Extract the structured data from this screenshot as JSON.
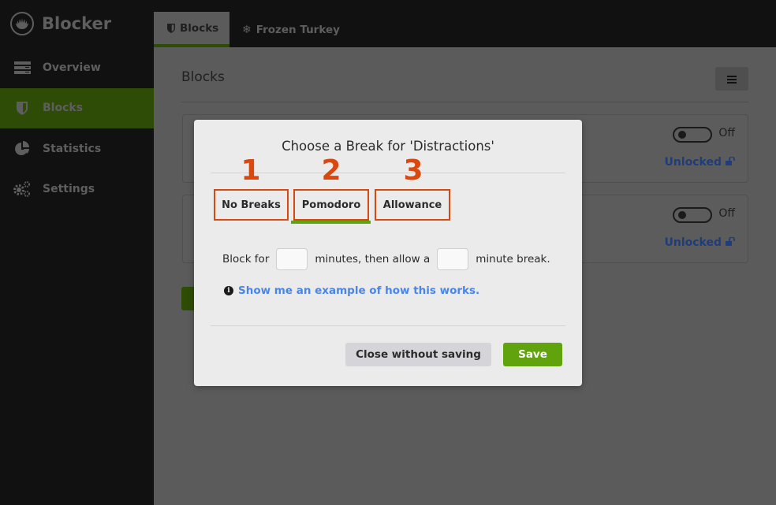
{
  "app": {
    "name": "Blocker",
    "logo_icon": "turkey-logo-icon"
  },
  "sidebar": {
    "items": [
      {
        "label": "Overview",
        "icon": "server-icon",
        "active": false
      },
      {
        "label": "Blocks",
        "icon": "shield-icon",
        "active": true
      },
      {
        "label": "Statistics",
        "icon": "pie-chart-icon",
        "active": false
      },
      {
        "label": "Settings",
        "icon": "gears-icon",
        "active": false
      }
    ]
  },
  "topbar": {
    "tabs": [
      {
        "label": "Blocks",
        "icon": "shield-icon",
        "active": true
      },
      {
        "label": "Frozen Turkey",
        "icon": "snowflake-icon",
        "active": false
      }
    ]
  },
  "main": {
    "title": "Blocks",
    "menu_icon": "hamburger-icon",
    "cards": [
      {
        "toggle_label": "Off",
        "toggle_on": false,
        "lock_status": "Unlocked",
        "lock_icon": "unlock-icon"
      },
      {
        "toggle_label": "Off",
        "toggle_on": false,
        "lock_status": "Unlocked",
        "lock_icon": "unlock-icon"
      }
    ]
  },
  "modal": {
    "title": "Choose a Break for 'Distractions'",
    "tabs": [
      {
        "number": "1",
        "label": "No Breaks",
        "active": false
      },
      {
        "number": "2",
        "label": "Pomodoro",
        "active": true
      },
      {
        "number": "3",
        "label": "Allowance",
        "active": false
      }
    ],
    "form": {
      "prefix": "Block for",
      "middle": "minutes, then allow a",
      "suffix": "minute break.",
      "block_minutes": "",
      "break_minutes": ""
    },
    "example_link": "Show me an example of how this works.",
    "close_button": "Close without saving",
    "save_button": "Save"
  },
  "colors": {
    "accent_green": "#61a30d",
    "annotation_orange": "#d9480f",
    "link_blue": "#4a86e8",
    "sidebar_bg": "#111111",
    "active_nav_dimmed": "#2e4c06"
  }
}
